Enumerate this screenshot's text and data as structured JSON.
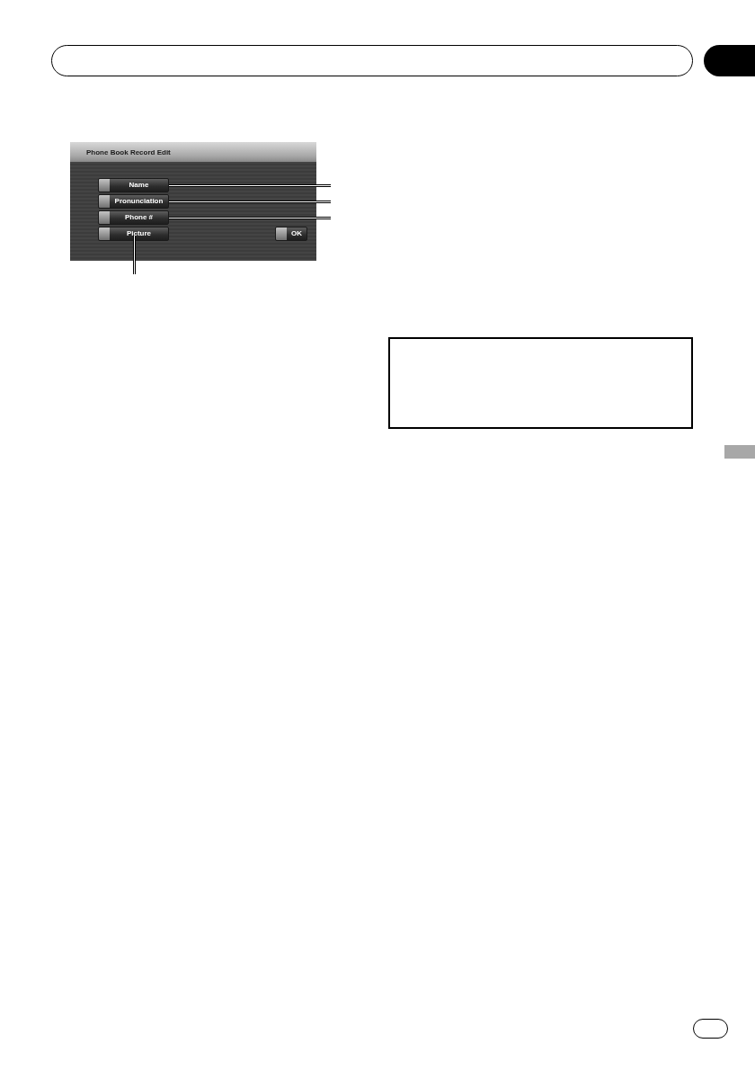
{
  "screen": {
    "title": "Phone Book Record Edit",
    "buttons": [
      {
        "label": "Name",
        "kind": "right"
      },
      {
        "label": "Pronunciation",
        "kind": "right"
      },
      {
        "label": "Phone #",
        "kind": "right"
      },
      {
        "label": "Picture",
        "kind": "down"
      }
    ],
    "ok_button": {
      "label": "OK"
    }
  }
}
